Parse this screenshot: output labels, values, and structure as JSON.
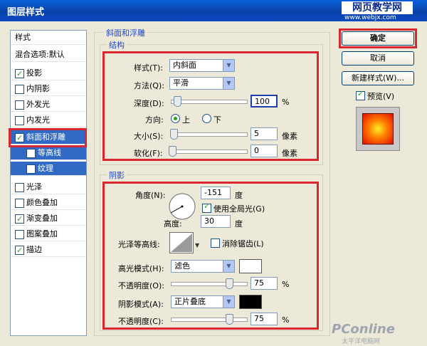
{
  "window": {
    "title": "图层样式"
  },
  "watermark": {
    "text": "网页教学网",
    "sub": "www.webjx.com",
    "bottom": "PConline",
    "bottom_sub": "太平洋电脑网"
  },
  "style_list": {
    "header": "样式",
    "blend": "混合选项:默认",
    "items": [
      {
        "label": "投影",
        "checked": true
      },
      {
        "label": "内阴影",
        "checked": false
      },
      {
        "label": "外发光",
        "checked": false
      },
      {
        "label": "内发光",
        "checked": false
      },
      {
        "label": "斜面和浮雕",
        "checked": true
      },
      {
        "label": "等高线",
        "checked": false
      },
      {
        "label": "纹理",
        "checked": false
      },
      {
        "label": "光泽",
        "checked": false
      },
      {
        "label": "颜色叠加",
        "checked": false
      },
      {
        "label": "渐变叠加",
        "checked": true
      },
      {
        "label": "图案叠加",
        "checked": false
      },
      {
        "label": "描边",
        "checked": true
      }
    ]
  },
  "bevel": {
    "group_title": "斜面和浮雕",
    "structure": {
      "title": "结构",
      "style_label": "样式(T):",
      "style_value": "内斜面",
      "method_label": "方法(Q):",
      "method_value": "平滑",
      "depth_label": "深度(D):",
      "depth_value": "100",
      "depth_unit": "%",
      "depth_fraction": 0.07,
      "direction_label": "方向:",
      "dir_up": "上",
      "dir_down": "下",
      "size_label": "大小(S):",
      "size_value": "5",
      "size_unit": "像素",
      "size_fraction": 0.02,
      "soften_label": "软化(F):",
      "soften_value": "0",
      "soften_unit": "像素",
      "soften_fraction": 0.0
    },
    "shading": {
      "title": "阴影",
      "angle_label": "角度(N):",
      "angle_value": "-151",
      "angle_unit": "度",
      "global_light_label": "使用全局光(G)",
      "altitude_label": "高度:",
      "altitude_value": "30",
      "altitude_unit": "度",
      "gloss_label": "光泽等高线:",
      "antialias_label": "消除锯齿(L)",
      "highlight_mode_label": "高光模式(H):",
      "highlight_mode_value": "滤色",
      "highlight_opacity_label": "不透明度(O):",
      "highlight_opacity_value": "75",
      "highlight_opacity_unit": "%",
      "highlight_opacity_fraction": 0.75,
      "shadow_mode_label": "阴影模式(A):",
      "shadow_mode_value": "正片叠底",
      "shadow_opacity_label": "不透明度(C):",
      "shadow_opacity_value": "75",
      "shadow_opacity_unit": "%",
      "shadow_opacity_fraction": 0.75
    }
  },
  "buttons": {
    "ok": "确定",
    "cancel": "取消",
    "new_style": "新建样式(W)...",
    "preview": "预览(V)"
  },
  "colors": {
    "highlight_color": "#ffffff",
    "shadow_color": "#000000",
    "accent": "#d8272e"
  }
}
